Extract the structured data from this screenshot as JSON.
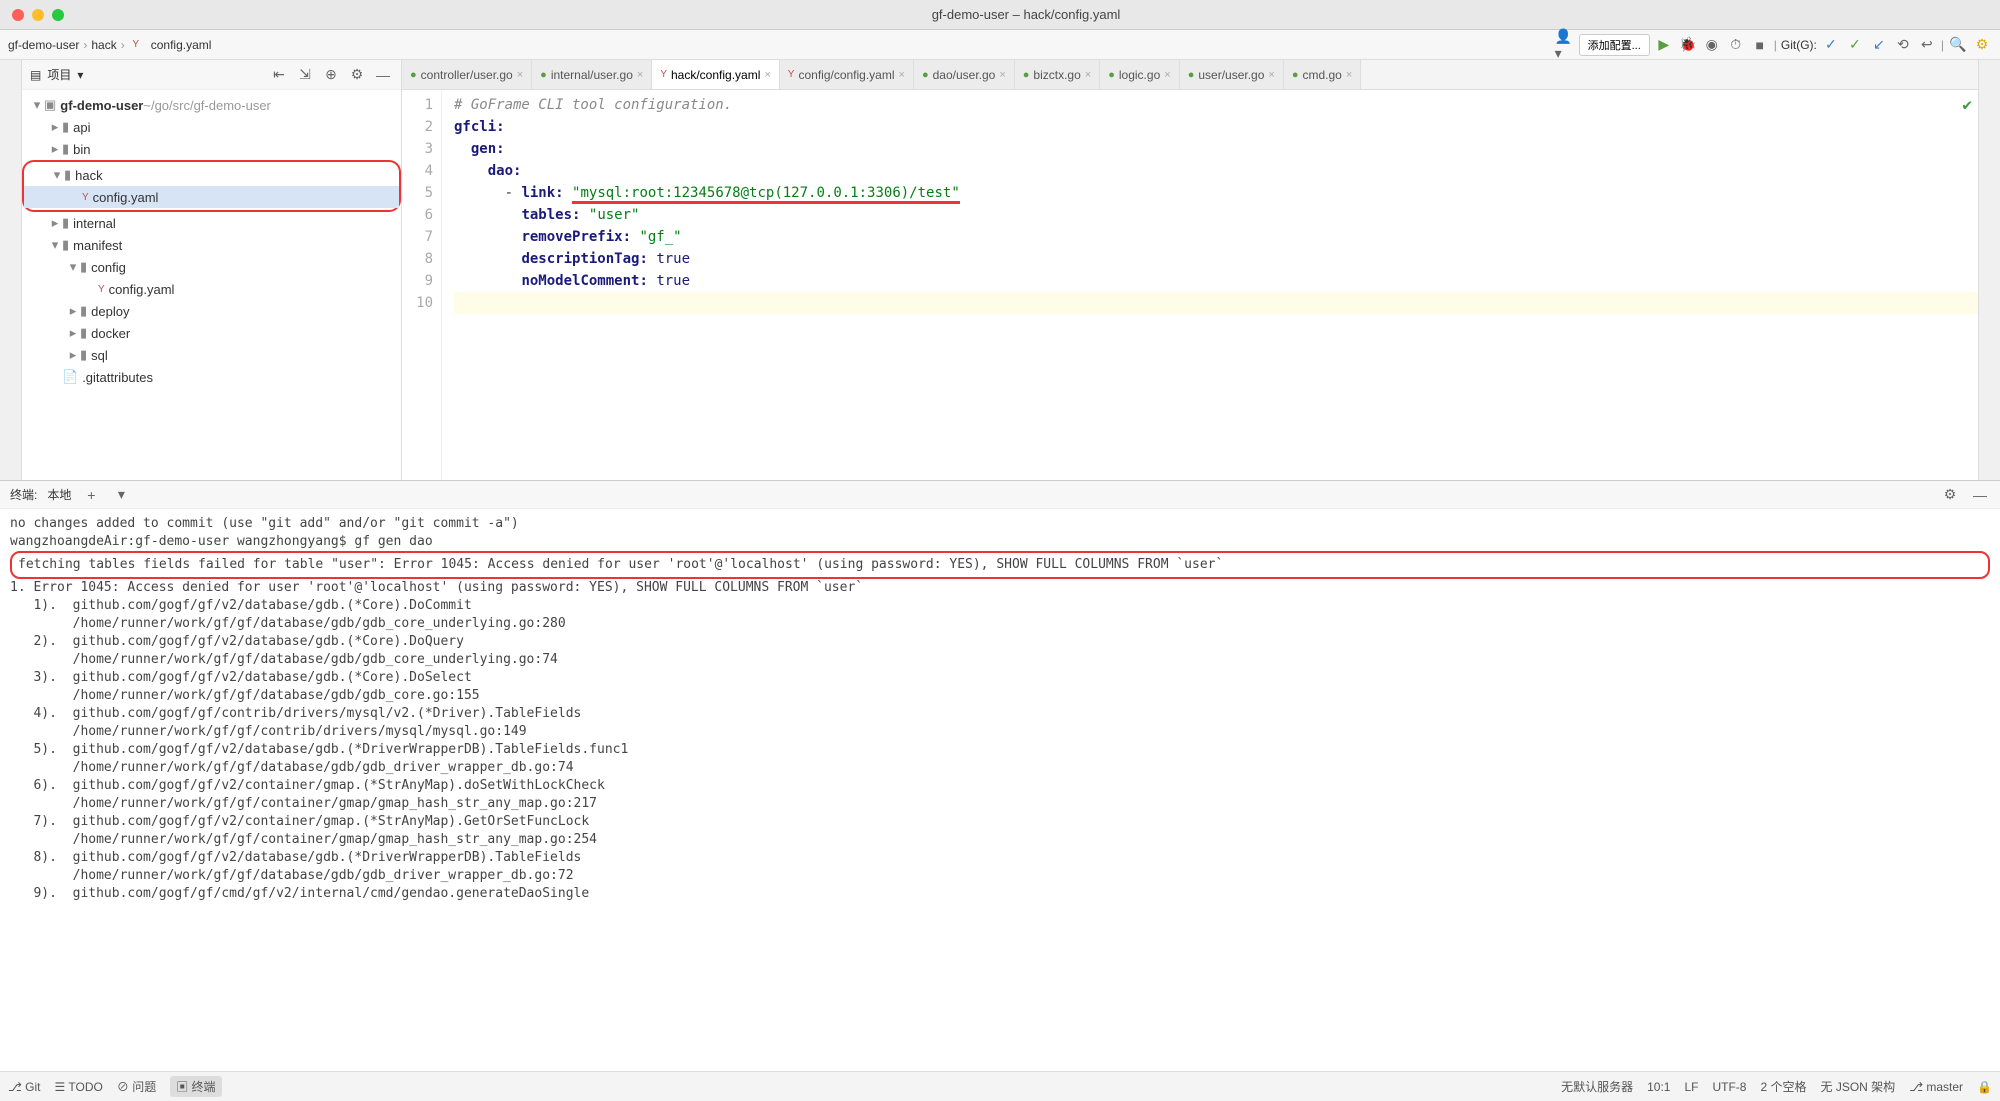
{
  "window": {
    "title": "gf-demo-user – hack/config.yaml"
  },
  "breadcrumbs": [
    "gf-demo-user",
    "hack",
    "config.yaml"
  ],
  "toolbar": {
    "add_config": "添加配置...",
    "git_label": "Git(G):"
  },
  "sidebar": {
    "title": "项目",
    "root": {
      "name": "gf-demo-user",
      "path": "~/go/src/gf-demo-user"
    },
    "items": [
      {
        "name": "api",
        "depth": 1,
        "type": "folder",
        "ex": false
      },
      {
        "name": "bin",
        "depth": 1,
        "type": "folder",
        "ex": false
      },
      {
        "name": "hack",
        "depth": 1,
        "type": "folder",
        "ex": true,
        "hl": true
      },
      {
        "name": "config.yaml",
        "depth": 2,
        "type": "yaml",
        "ex": null,
        "hl": true,
        "sel": true
      },
      {
        "name": "internal",
        "depth": 1,
        "type": "folder",
        "ex": false
      },
      {
        "name": "manifest",
        "depth": 1,
        "type": "folder",
        "ex": true
      },
      {
        "name": "config",
        "depth": 2,
        "type": "folder",
        "ex": true
      },
      {
        "name": "config.yaml",
        "depth": 3,
        "type": "yaml",
        "ex": null
      },
      {
        "name": "deploy",
        "depth": 2,
        "type": "folder",
        "ex": false
      },
      {
        "name": "docker",
        "depth": 2,
        "type": "folder",
        "ex": false
      },
      {
        "name": "sql",
        "depth": 2,
        "type": "folder",
        "ex": false
      },
      {
        "name": ".gitattributes",
        "depth": 1,
        "type": "file",
        "ex": null
      }
    ]
  },
  "tabs": [
    {
      "label": "controller/user.go",
      "icon": "go",
      "active": false
    },
    {
      "label": "internal/user.go",
      "icon": "go",
      "active": false
    },
    {
      "label": "hack/config.yaml",
      "icon": "yaml",
      "active": true
    },
    {
      "label": "config/config.yaml",
      "icon": "yaml",
      "active": false
    },
    {
      "label": "dao/user.go",
      "icon": "go",
      "active": false
    },
    {
      "label": "bizctx.go",
      "icon": "go",
      "active": false
    },
    {
      "label": "logic.go",
      "icon": "go",
      "active": false
    },
    {
      "label": "user/user.go",
      "icon": "go",
      "active": false
    },
    {
      "label": "cmd.go",
      "icon": "go",
      "active": false
    }
  ],
  "editor": {
    "comment": "# GoFrame CLI tool configuration.",
    "k_gfcli": "gfcli:",
    "k_gen": "gen:",
    "k_dao": "dao:",
    "k_link": "link:",
    "v_link": "\"mysql:root:12345678@tcp(127.0.0.1:3306)/test\"",
    "k_tables": "tables:",
    "v_tables": "\"user\"",
    "k_removePrefix": "removePrefix:",
    "v_removePrefix": "\"gf_\"",
    "k_descriptionTag": "descriptionTag:",
    "v_descriptionTag": "true",
    "k_noModelComment": "noModelComment:",
    "v_noModelComment": "true",
    "line_numbers": [
      "1",
      "2",
      "3",
      "4",
      "5",
      "6",
      "7",
      "8",
      "9",
      "10"
    ]
  },
  "terminal": {
    "tab_label": "终端:",
    "sub_tab": "本地",
    "lines": [
      "no changes added to commit (use \"git add\" and/or \"git commit -a\")",
      "wangzhoangdeAir:gf-demo-user wangzhongyang$ gf gen dao",
      "fetching tables fields failed for table \"user\": Error 1045: Access denied for user 'root'@'localhost' (using password: YES), SHOW FULL COLUMNS FROM `user`",
      "1. Error 1045: Access denied for user 'root'@'localhost' (using password: YES), SHOW FULL COLUMNS FROM `user`",
      "   1).  github.com/gogf/gf/v2/database/gdb.(*Core).DoCommit",
      "        /home/runner/work/gf/gf/database/gdb/gdb_core_underlying.go:280",
      "   2).  github.com/gogf/gf/v2/database/gdb.(*Core).DoQuery",
      "        /home/runner/work/gf/gf/database/gdb/gdb_core_underlying.go:74",
      "   3).  github.com/gogf/gf/v2/database/gdb.(*Core).DoSelect",
      "        /home/runner/work/gf/gf/database/gdb/gdb_core.go:155",
      "   4).  github.com/gogf/gf/contrib/drivers/mysql/v2.(*Driver).TableFields",
      "        /home/runner/work/gf/gf/contrib/drivers/mysql/mysql.go:149",
      "   5).  github.com/gogf/gf/v2/database/gdb.(*DriverWrapperDB).TableFields.func1",
      "        /home/runner/work/gf/gf/database/gdb/gdb_driver_wrapper_db.go:74",
      "   6).  github.com/gogf/gf/v2/container/gmap.(*StrAnyMap).doSetWithLockCheck",
      "        /home/runner/work/gf/gf/container/gmap/gmap_hash_str_any_map.go:217",
      "   7).  github.com/gogf/gf/v2/container/gmap.(*StrAnyMap).GetOrSetFuncLock",
      "        /home/runner/work/gf/gf/container/gmap/gmap_hash_str_any_map.go:254",
      "   8).  github.com/gogf/gf/v2/database/gdb.(*DriverWrapperDB).TableFields",
      "        /home/runner/work/gf/gf/database/gdb/gdb_driver_wrapper_db.go:72",
      "   9).  github.com/gogf/gf/cmd/gf/v2/internal/cmd/gendao.generateDaoSingle"
    ],
    "highlight_index": 2
  },
  "statusbar": {
    "git": "Git",
    "todo": "TODO",
    "issues": "问题",
    "terminal": "终端",
    "server": "无默认服务器",
    "pos": "10:1",
    "lf": "LF",
    "enc": "UTF-8",
    "indent": "2 个空格",
    "schema": "无 JSON 架构",
    "branch": "master"
  }
}
